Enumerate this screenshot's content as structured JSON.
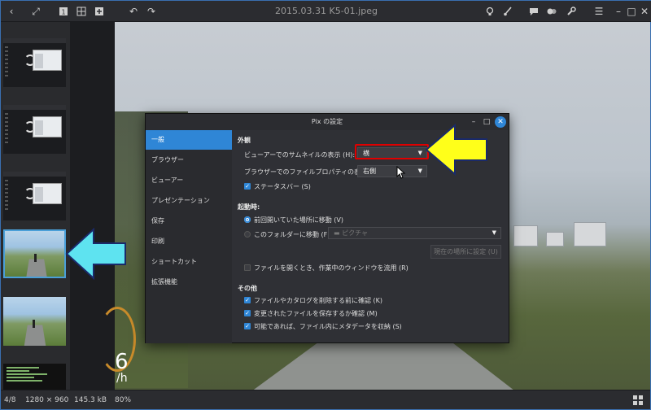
{
  "toolbar": {
    "title": "2015.03.31 K5-01.jpeg",
    "icons": [
      "back-icon",
      "fullscreen-icon",
      "view-single-icon",
      "view-add-icon",
      "view-plus-icon",
      "rotate-left-icon",
      "rotate-right-icon",
      "lightbulb-icon",
      "brush-icon",
      "comment-icon",
      "tags-icon",
      "wrench-icon",
      "menu-icon",
      "minimize-icon",
      "maximize-icon",
      "close-icon"
    ]
  },
  "viewer": {
    "overlay_speed": "6",
    "overlay_unit": "/h"
  },
  "dialog": {
    "title": "Pix の設定",
    "nav": [
      "一般",
      "ブラウザー",
      "ビューアー",
      "プレゼンテーション",
      "保存",
      "印刷",
      "ショートカット",
      "拡張機能"
    ],
    "active_nav": 0,
    "appearance": {
      "heading": "外観",
      "thumb_label": "ビューアーでのサムネイルの表示 (H):",
      "thumb_value": "横",
      "props_label": "ブラウザーでのファイルプロパティの表示 (P):",
      "props_value": "右側",
      "statusbar_label": "ステータスバー (S)",
      "statusbar_checked": true
    },
    "startup": {
      "heading": "起動時:",
      "radio_last": "前回開いていた場所に移動 (V)",
      "radio_folder": "このフォルダーに移動 (F):",
      "folder_value": "ピクチャ",
      "set_current_button": "現在の場所に設定 (U)",
      "reuse_window": "ファイルを開くとき、作業中のウィンドウを流用 (R)",
      "reuse_checked": false
    },
    "other": {
      "heading": "その他",
      "confirm_delete": "ファイルやカタログを削除する前に確認 (K)",
      "confirm_save": "変更されたファイルを保存するか確認 (M)",
      "save_metadata": "可能であれば、ファイル内にメタデータを収納 (S)"
    }
  },
  "status": {
    "position": "4/8",
    "dimensions": "1280 × 960",
    "size": "145.3 kB",
    "zoom": "80%"
  },
  "colors": {
    "accent": "#2f86d6",
    "annotation_red": "#e00000",
    "arrow_yellow": "#ffff1a",
    "arrow_cyan": "#5ee3f0"
  }
}
